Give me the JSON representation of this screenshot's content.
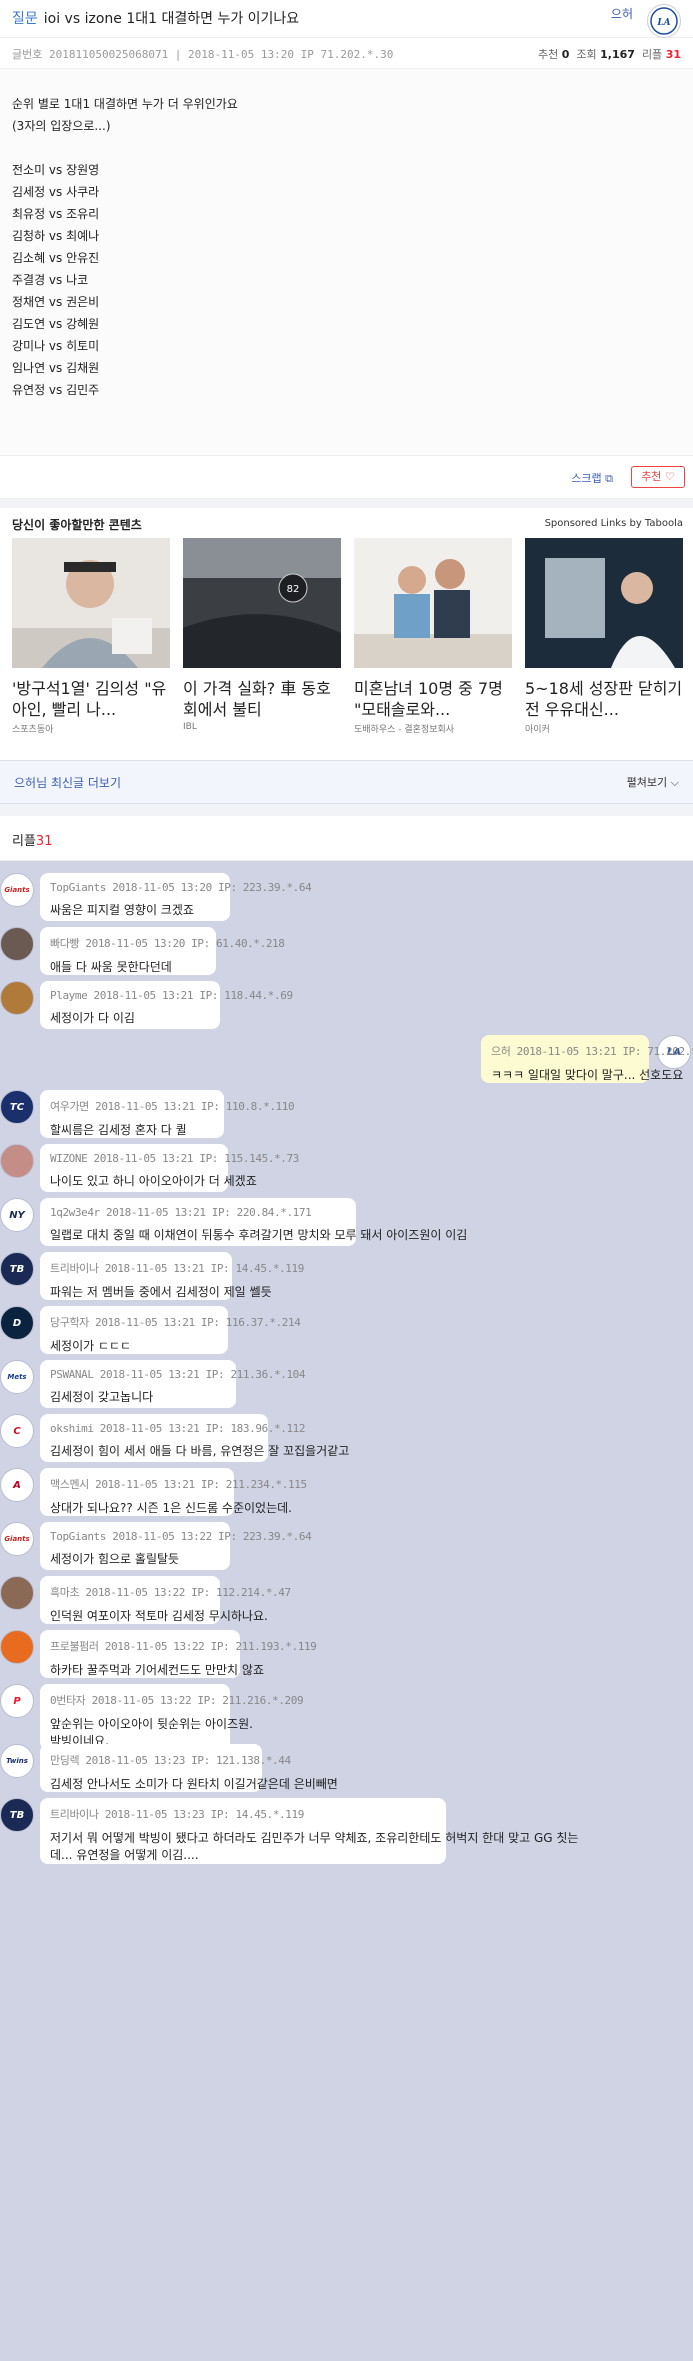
{
  "post": {
    "category": "질문",
    "title": "ioi vs izone 1대1 대결하면 누가 이기나요",
    "author": "으허",
    "meta_left": "글번호 201811050025068071 | 2018-11-05 13:20   IP 71.202.*.30",
    "rec_label": "추천",
    "rec": "0",
    "views_label": "조회",
    "views": "1,167",
    "replies_label": "리플",
    "replies": "31",
    "body_lines": [
      "순위 별로 1대1 대결하면 누가 더 우위인가요",
      "(3자의 입장으로...)",
      "",
      "전소미 vs 장원영",
      "김세정 vs 사쿠라",
      "최유정 vs 조유리",
      "김청하 vs 최예나",
      "김소혜 vs 안유진",
      "주결경 vs 나코",
      "정채연 vs 권은비",
      "김도연 vs 강혜원",
      "강미나 vs 히토미",
      "임나연 vs 김채원",
      "유연정 vs 김민주"
    ],
    "scrap_label": "스크랩",
    "recommend_button": "추천 ♡"
  },
  "sponsored": {
    "heading": "당신이 좋아할만한 콘텐츠",
    "by": "Sponsored Links by Taboola",
    "cards": [
      {
        "title": "'방구석1열' 김의성 \"유아인, 빨리 나...",
        "source": "스포츠동아"
      },
      {
        "title": "이 가격 실화? 車 동호회에서 불티",
        "source": "IBL"
      },
      {
        "title": "미혼남녀 10명 중 7명 \"모태솔로와...",
        "source": "도배하우스 - 결혼정보회사"
      },
      {
        "title": "5~18세 성장판 닫히기전 우유대신...",
        "source": "아이커"
      }
    ]
  },
  "more": {
    "author": "으허",
    "label": "님 최신글 더보기",
    "toggle": "펼쳐보기 ⌵"
  },
  "replies_header": {
    "label": "리플",
    "count": "31"
  },
  "comments": [
    {
      "avatar": "giants-icon",
      "color": "#fff",
      "fg": "#c22",
      "glyph": "Giants",
      "nick": "TopGiants",
      "head": "TopGiants 2018-11-05 13:20 IP: 223.39.*.64",
      "text": "싸움은 피지컬 영향이 크겠죠"
    },
    {
      "avatar": "user-photo-icon",
      "color": "#6b5a52",
      "fg": "#fff",
      "glyph": "",
      "nick": "빠다빵",
      "head": "빠다빵 2018-11-05 13:20 IP: 61.40.*.218",
      "text": "애들 다 싸움 못한다던데"
    },
    {
      "avatar": "user-photo-icon",
      "color": "#b07a3a",
      "fg": "#fff",
      "glyph": "",
      "nick": "Playme",
      "head": "Playme 2018-11-05 13:21 IP: 118.44.*.69",
      "text": "세정이가 다 이김"
    },
    {
      "avatar": "dodgers-icon",
      "color": "#fff",
      "fg": "#1e4ea0",
      "glyph": "LA",
      "nick": "으허",
      "head": "으허 2018-11-05 13:21 IP: 71.202.*.30",
      "text": "ㅋㅋㅋ 일대일 맞다이 말구... 선호도요",
      "mine": true
    },
    {
      "avatar": "twins-icon",
      "color": "#1a2f6b",
      "fg": "#fff",
      "glyph": "TC",
      "nick": "여우가면",
      "head": "여우가면 2018-11-05 13:21 IP: 110.8.*.110",
      "text": "할씨름은 김세정 혼자 다 퀼"
    },
    {
      "avatar": "user-photo-icon",
      "color": "#c48d86",
      "fg": "#fff",
      "glyph": "",
      "nick": "WIZONE",
      "head": "WIZONE 2018-11-05 13:21 IP: 115.145.*.73",
      "text": "나이도 있고 하니 아이오아이가 더 세겠죠"
    },
    {
      "avatar": "yankees-icon",
      "color": "#fff",
      "fg": "#1a2a55",
      "glyph": "NY",
      "nick": "1q2w3e4r",
      "head": "1q2w3e4r 2018-11-05 13:21 IP: 220.84.*.171",
      "text": "일랩로 대치 중일 때 이채연이 뒤통수 후려갈기면 망치와 모루 돼서 아이즈원이 이김"
    },
    {
      "avatar": "pelicans-icon",
      "color": "#1a2a55",
      "fg": "#fff",
      "glyph": "TB",
      "nick": "트리바이나",
      "head": "트리바이나 2018-11-05 13:21 IP: 14.45.*.119",
      "text": "파워는 저 멤버들 중에서 김세정이 제일 쎌듯"
    },
    {
      "avatar": "tigers-icon",
      "color": "#0c2340",
      "fg": "#fff",
      "glyph": "D",
      "nick": "당구학자",
      "head": "당구학자 2018-11-05 13:21 IP: 116.37.*.214",
      "text": "세정이가 ㄷㄷㄷ"
    },
    {
      "avatar": "mets-icon",
      "color": "#fff",
      "fg": "#1a3d8f",
      "glyph": "Mets",
      "nick": "PSWANAL",
      "head": "PSWANAL 2018-11-05 13:21 IP: 211.36.*.104",
      "text": "김세정이 갖고놉니다"
    },
    {
      "avatar": "reds-icon",
      "color": "#fff",
      "fg": "#c8102e",
      "glyph": "C",
      "nick": "okshimi",
      "head": "okshimi 2018-11-05 13:21 IP: 183.96.*.112",
      "text": "김세정이 힘이 세서 애들 다 바름, 유연정은 잘 꼬집을거같고"
    },
    {
      "avatar": "angels-icon",
      "color": "#fff",
      "fg": "#ba0021",
      "glyph": "A",
      "nick": "맥스멘시",
      "head": "맥스멘시 2018-11-05 13:21 IP: 211.234.*.115",
      "text": "상대가 되나요?? 시즌 1은 신드롬 수준이었는데."
    },
    {
      "avatar": "giants-icon",
      "color": "#fff",
      "fg": "#c22",
      "glyph": "Giants",
      "nick": "TopGiants",
      "head": "TopGiants 2018-11-05 13:22 IP: 223.39.*.64",
      "text": "세정이가 힘으로 홀릴탈듯"
    },
    {
      "avatar": "user-photo-icon",
      "color": "#8a6a55",
      "fg": "#fff",
      "glyph": "",
      "nick": "흑마초",
      "head": "흑마초 2018-11-05 13:22 IP: 112.214.*.47",
      "text": "인덕원 여포이자 적토마 김세정 무시하나요."
    },
    {
      "avatar": "basketball-icon",
      "color": "#e86b1f",
      "fg": "#fff",
      "glyph": "",
      "nick": "프로불펌러",
      "head": "프로불펌러 2018-11-05 13:22 IP: 211.193.*.119",
      "text": "하카타 꿀주먹과 기어세컨드도 만만치 않죠"
    },
    {
      "avatar": "phillies-icon",
      "color": "#fff",
      "fg": "#e81828",
      "glyph": "P",
      "nick": "0번타자",
      "head": "0번타자 2018-11-05 13:22 IP: 211.216.*.209",
      "text": "앞순위는 아이오아이 뒷순위는 아이즈원.\n박빙이네요."
    },
    {
      "avatar": "twins-icon",
      "color": "#fff",
      "fg": "#1a2f6b",
      "glyph": "Twins",
      "nick": "만딩렉",
      "head": "만딩렉 2018-11-05 13:23 IP: 121.138.*.44",
      "text": "김세정 안나서도 소미가 다 원타치 이길거같은데 은비빼면"
    },
    {
      "avatar": "pelicans-icon",
      "color": "#1a2a55",
      "fg": "#fff",
      "glyph": "TB",
      "nick": "트리바이나",
      "head": "트리바이나 2018-11-05 13:23 IP: 14.45.*.119",
      "text": "저기서 뭐 어떻게 박빙이 됐다고 하더라도 김민주가 너무 약체죠, 조유리한테도 허벅지 한대 맞고 GG 칫는\n데... 유연정을 어떻게 이김...."
    }
  ]
}
